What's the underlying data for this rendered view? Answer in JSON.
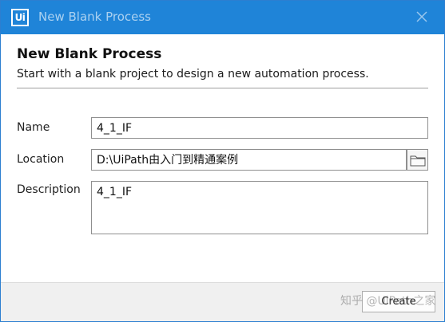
{
  "window": {
    "title": "New Blank Process",
    "app_logo_text": "Ui",
    "close_icon": "close-icon",
    "accent_color": "#1f84d8"
  },
  "header": {
    "title": "New Blank Process",
    "subtitle": "Start with a blank project to design a new automation process."
  },
  "form": {
    "name": {
      "label": "Name",
      "value": "4_1_IF"
    },
    "location": {
      "label": "Location",
      "value": "D:\\UiPath由入门到精通案例",
      "browse_icon": "folder-icon"
    },
    "description": {
      "label": "Description",
      "value": "4_1_IF"
    }
  },
  "footer": {
    "create_label": "Create"
  },
  "watermark": {
    "text": "知乎 @UiPath之家"
  }
}
